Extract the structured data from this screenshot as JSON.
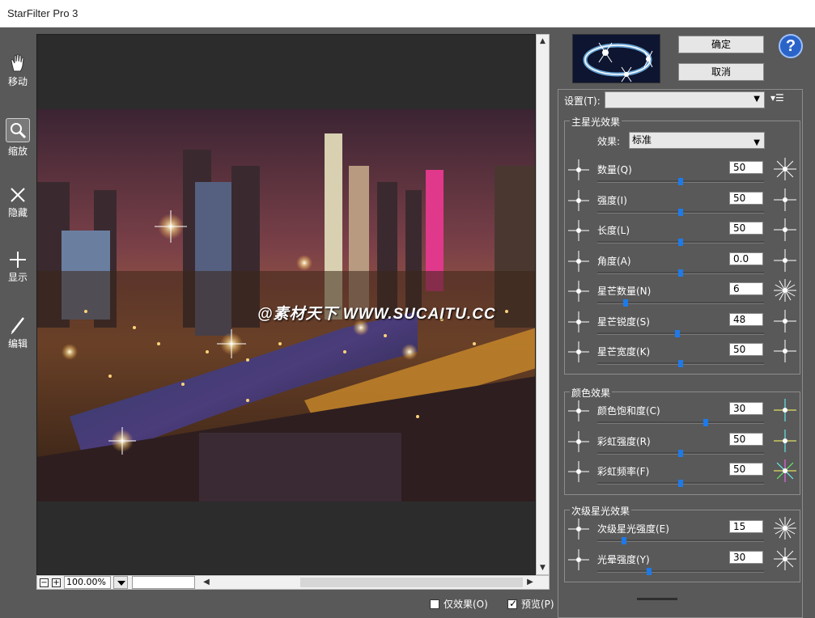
{
  "window": {
    "title": "StarFilter Pro 3"
  },
  "tools": [
    {
      "name": "move",
      "label": "移动"
    },
    {
      "name": "zoom",
      "label": "缩放"
    },
    {
      "name": "hide",
      "label": "隐藏"
    },
    {
      "name": "show",
      "label": "显示"
    },
    {
      "name": "edit",
      "label": "编辑"
    }
  ],
  "preview": {
    "watermark": "@素材天下 WWW.SUCAITU.CC"
  },
  "status": {
    "zoom": "100.00%"
  },
  "checkboxes": {
    "effect_only": "仅效果(O)",
    "preview": "预览(P)"
  },
  "buttons": {
    "ok": "确定",
    "cancel": "取消",
    "help": "?"
  },
  "settings": {
    "label": "设置(T):",
    "value": "",
    "menu": "☰"
  },
  "main_star": {
    "title": "主星光效果",
    "effect_label": "效果:",
    "effect_value": "标准",
    "params": [
      {
        "label": "数量(Q)",
        "value": "50",
        "level": 50
      },
      {
        "label": "强度(I)",
        "value": "50",
        "level": 50
      },
      {
        "label": "长度(L)",
        "value": "50",
        "level": 50
      },
      {
        "label": "角度(A)",
        "value": "0.0",
        "level": 50
      },
      {
        "label": "星芒数量(N)",
        "value": "6",
        "level": 17
      },
      {
        "label": "星芒锐度(S)",
        "value": "48",
        "level": 48
      },
      {
        "label": "星芒宽度(K)",
        "value": "50",
        "level": 50
      }
    ]
  },
  "color": {
    "title": "颜色效果",
    "params": [
      {
        "label": "颜色饱和度(C)",
        "value": "30",
        "level": 65
      },
      {
        "label": "彩虹强度(R)",
        "value": "50",
        "level": 50
      },
      {
        "label": "彩虹频率(F)",
        "value": "50",
        "level": 50
      }
    ]
  },
  "secondary": {
    "title": "次级星光效果",
    "params": [
      {
        "label": "次级星光强度(E)",
        "value": "15",
        "level": 16
      },
      {
        "label": "光晕强度(Y)",
        "value": "30",
        "level": 31
      }
    ]
  }
}
